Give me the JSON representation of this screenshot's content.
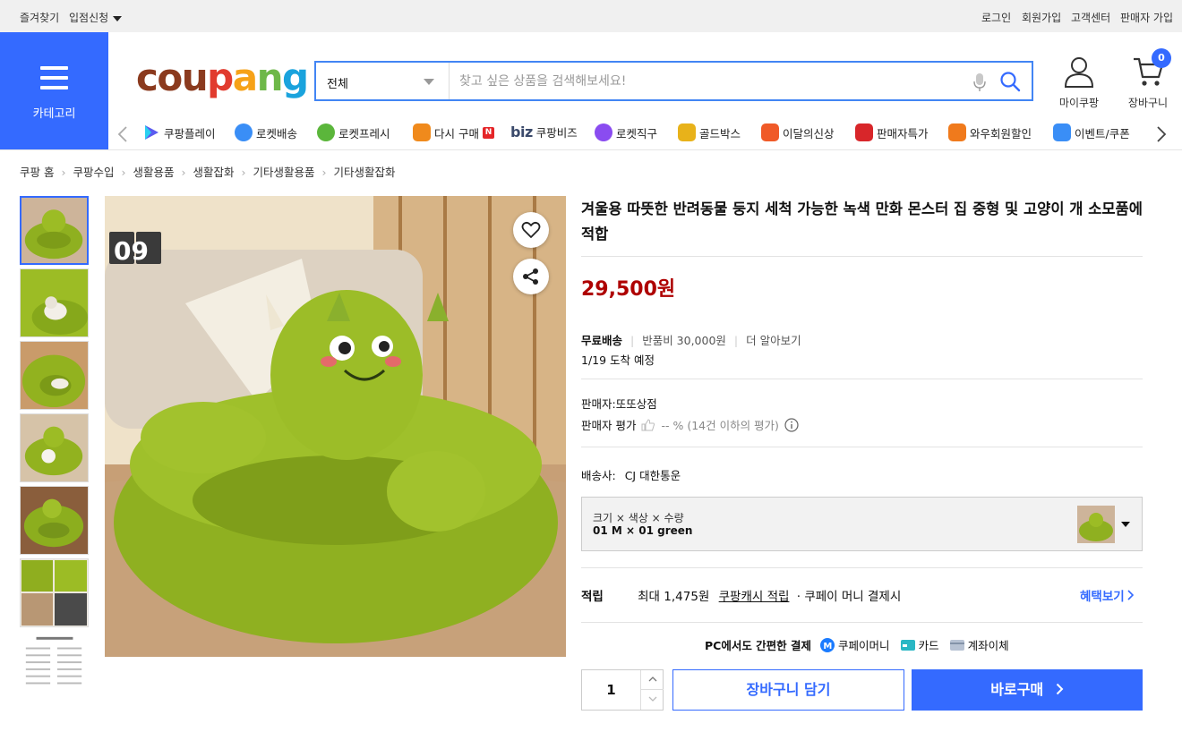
{
  "topbar": {
    "favorites": "즐겨찾기",
    "apply": "입점신청",
    "login": "로그인",
    "signup": "회원가입",
    "customer_center": "고객센터",
    "seller_signup": "판매자 가입"
  },
  "header": {
    "category_label": "카테고리",
    "logo": [
      "c",
      "o",
      "u",
      "p",
      "a",
      "n",
      "g"
    ],
    "logo_colors": [
      "#8b3a1e",
      "#8b3a1e",
      "#8b3a1e",
      "#e13b2e",
      "#f6a218",
      "#6eb849",
      "#1aa3dd"
    ],
    "search_scope": "전체",
    "search_placeholder": "찾고 싶은 상품을 검색해보세요!",
    "mycoupang": "마이쿠팡",
    "cart": "장바구니",
    "cart_count": "0",
    "accent": "#346aff"
  },
  "catnav": [
    {
      "label": "쿠팡플레이",
      "icon": "coupang-play-icon"
    },
    {
      "label": "로켓배송",
      "icon": "rocket-icon"
    },
    {
      "label": "로켓프레시",
      "icon": "rocket-fresh-icon"
    },
    {
      "label": "다시 구매",
      "icon": "rebuy-icon"
    },
    {
      "label": "쿠팡비즈",
      "icon": "biz-icon"
    },
    {
      "label": "로켓직구",
      "icon": "rocket-global-icon"
    },
    {
      "label": "골드박스",
      "icon": "goldbox-icon"
    },
    {
      "label": "이달의신상",
      "icon": "new-bag-icon"
    },
    {
      "label": "판매자특가",
      "icon": "discount-icon"
    },
    {
      "label": "와우회원할인",
      "icon": "wow-icon"
    },
    {
      "label": "이벤트/쿠폰",
      "icon": "event-icon"
    }
  ],
  "catnav_badge_n": "N",
  "catnav_biz": "biz",
  "breadcrumb": [
    "쿠팡 홈",
    "쿠팡수입",
    "생활용품",
    "생활잡화",
    "기타생활용품",
    "기타생활잡화"
  ],
  "product": {
    "title": "겨울용 따뜻한 반려동물 둥지 세척 가능한 녹색 만화 몬스터 집 중형 및 고양이 개 소모품에 적합",
    "price": "29,500원",
    "shipping_free": "무료배송",
    "return_fee": "반품비 30,000원",
    "learn_more": "더 알아보기",
    "arrival": "1/19 도착 예정",
    "seller": "판매자:또또상점",
    "seller_rating_label": "판매자 평가",
    "seller_rating_value": "-- % (14건 이하의 평가)",
    "carrier_label": "배송사:",
    "carrier": "CJ 대한통운",
    "option_header": "크기 × 색상 × 수량",
    "option_value": "01 M × 01 green",
    "reward_label": "적립",
    "reward_max": "최대 1,475원",
    "reward_link": "쿠팡캐시 적립",
    "reward_desc": "· 쿠페이 머니 결제시",
    "benefit_link": "혜택보기",
    "pay_title": "PC에서도 간편한 결제",
    "pay_money": "쿠페이머니",
    "pay_card": "카드",
    "pay_bank": "계좌이체",
    "quantity": "1",
    "add_to_cart": "장바구니 담기",
    "buy_now": "바로구매",
    "main_image_number": "09"
  }
}
